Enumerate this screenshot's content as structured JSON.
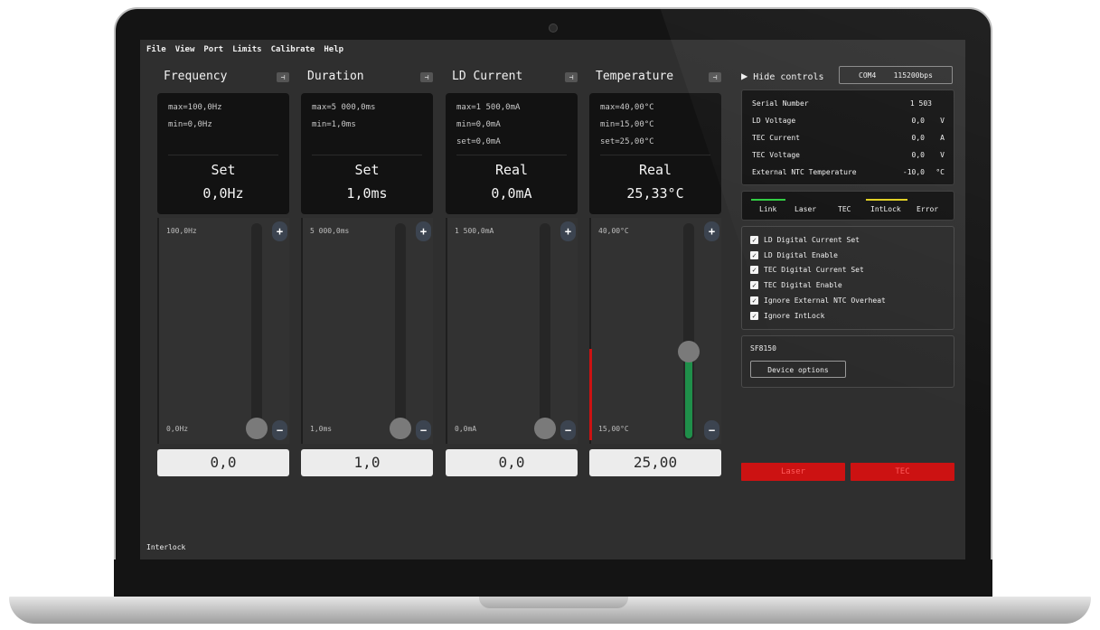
{
  "menu": [
    "File",
    "View",
    "Port",
    "Limits",
    "Calibrate",
    "Help"
  ],
  "panels": [
    {
      "title": "Frequency",
      "lines": [
        "max=100,0Hz",
        "min=0,0Hz"
      ],
      "mode": "Set",
      "value": "0,0Hz",
      "slider_max": "100,0Hz",
      "slider_min": "0,0Hz",
      "input": "0,0",
      "slider_level": 0
    },
    {
      "title": "Duration",
      "lines": [
        "max=5 000,0ms",
        "min=1,0ms"
      ],
      "mode": "Set",
      "value": "1,0ms",
      "slider_max": "5 000,0ms",
      "slider_min": "1,0ms",
      "input": "1,0",
      "slider_level": 0
    },
    {
      "title": "LD Current",
      "lines": [
        "max=1 500,0mA",
        "min=0,0mA",
        "set=0,0mA"
      ],
      "mode": "Real",
      "value": "0,0mA",
      "slider_max": "1 500,0mA",
      "slider_min": "0,0mA",
      "input": "0,0",
      "slider_level": 0
    },
    {
      "title": "Temperature",
      "lines": [
        "max=40,00°C",
        "min=15,00°C",
        "set=25,00°C"
      ],
      "mode": "Real",
      "value": "25,33°C",
      "slider_max": "40,00°C",
      "slider_min": "15,00°C",
      "input": "25,00",
      "slider_level": 0.4
    }
  ],
  "controls": {
    "hide_label": "Hide controls",
    "port": "COM4",
    "baud": "115200bps"
  },
  "info": [
    {
      "label": "Serial Number",
      "value": "1 503",
      "unit": ""
    },
    {
      "label": "LD Voltage",
      "value": "0,0",
      "unit": "V"
    },
    {
      "label": "TEC Current",
      "value": "0,0",
      "unit": "A"
    },
    {
      "label": "TEC Voltage",
      "value": "0,0",
      "unit": "V"
    },
    {
      "label": "External NTC Temperature",
      "value": "-10,0",
      "unit": "°C"
    }
  ],
  "indicators": [
    "Link",
    "Laser",
    "TEC",
    "IntLock",
    "Error"
  ],
  "indicator_colors": {
    "Link": "#2ecc40",
    "IntLock": "#e0d020"
  },
  "checkboxes": [
    "LD Digital Current Set",
    "LD Digital Enable",
    "TEC Digital Current Set",
    "TEC Digital Enable",
    "Ignore External NTC Overheat",
    "Ignore IntLock"
  ],
  "device": {
    "name": "SF8150",
    "options_label": "Device options"
  },
  "actions": {
    "laser": "Laser",
    "tec": "TEC"
  },
  "status": "Interlock",
  "colors": {
    "accent_red": "#cc1212",
    "temp_fill": "#1f8f4a"
  }
}
